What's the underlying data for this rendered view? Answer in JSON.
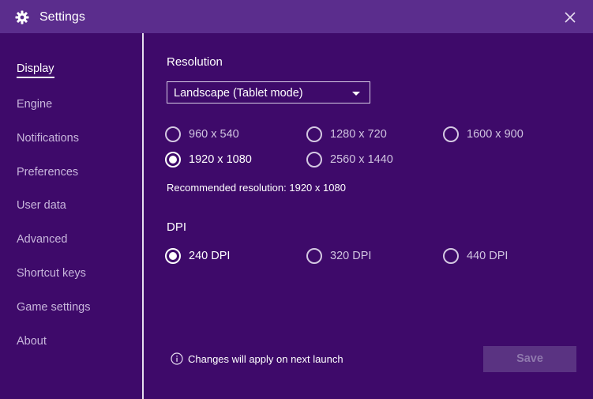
{
  "window": {
    "title": "Settings"
  },
  "sidebar": {
    "items": [
      {
        "label": "Display",
        "active": true
      },
      {
        "label": "Engine"
      },
      {
        "label": "Notifications"
      },
      {
        "label": "Preferences"
      },
      {
        "label": "User data"
      },
      {
        "label": "Advanced"
      },
      {
        "label": "Shortcut keys"
      },
      {
        "label": "Game settings"
      },
      {
        "label": "About"
      }
    ]
  },
  "resolution": {
    "heading": "Resolution",
    "mode": "Landscape (Tablet mode)",
    "options": [
      "960 x 540",
      "1280 x 720",
      "1600 x 900",
      "1920 x 1080",
      "2560 x 1440"
    ],
    "selected": "1920 x 1080",
    "recommended": "Recommended resolution: 1920 x 1080"
  },
  "dpi": {
    "heading": "DPI",
    "options": [
      "240 DPI",
      "320 DPI",
      "440 DPI"
    ],
    "selected": "240 DPI"
  },
  "footer": {
    "note": "Changes will apply on next launch",
    "save_label": "Save"
  },
  "colors": {
    "window_bg": "#3e0a6a",
    "titlebar_bg": "#5b2d8d",
    "save_bg": "#5a3382"
  },
  "icons": {
    "title": "gear-icon",
    "close": "close-icon",
    "dropdown": "caret-down-icon",
    "note": "info-icon"
  }
}
